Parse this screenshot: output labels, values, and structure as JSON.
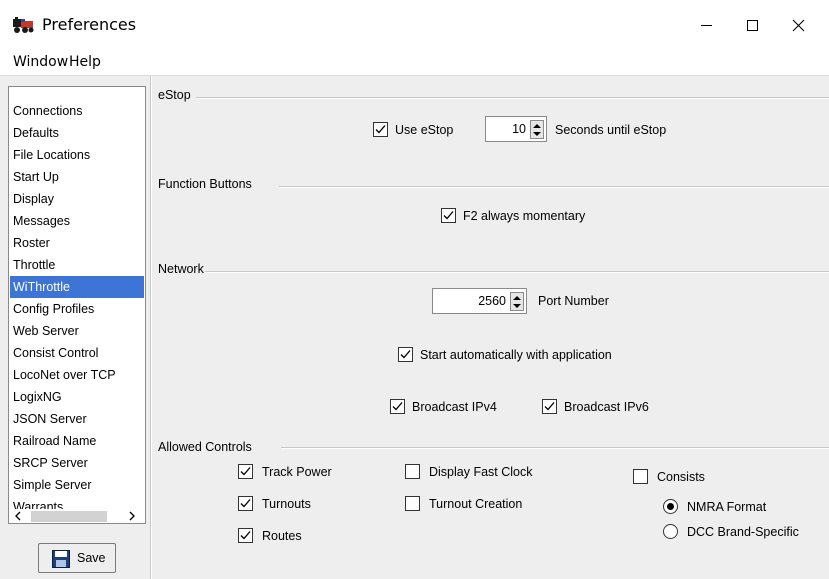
{
  "window": {
    "title": "Preferences",
    "icon": "locomotive-icon",
    "controls": [
      "minimize-icon",
      "maximize-icon",
      "close-icon"
    ]
  },
  "menu": {
    "window": "Window",
    "help": "Help"
  },
  "sidebar": {
    "items": [
      {
        "label": "Connections"
      },
      {
        "label": "Defaults"
      },
      {
        "label": "File Locations"
      },
      {
        "label": "Start Up"
      },
      {
        "label": "Display"
      },
      {
        "label": "Messages"
      },
      {
        "label": "Roster"
      },
      {
        "label": "Throttle"
      },
      {
        "label": "WiThrottle"
      },
      {
        "label": "Config Profiles"
      },
      {
        "label": "Web Server"
      },
      {
        "label": "Consist Control"
      },
      {
        "label": "LocoNet over TCP"
      },
      {
        "label": "LogixNG"
      },
      {
        "label": "JSON Server"
      },
      {
        "label": "Railroad Name"
      },
      {
        "label": "SRCP Server"
      },
      {
        "label": "Simple Server"
      },
      {
        "label": "Warrants"
      }
    ],
    "selected": "WiThrottle",
    "save_label": "Save",
    "selected_color": "#3d74d6"
  },
  "estop": {
    "title": "eStop",
    "use_label": "Use eStop",
    "use_checked": true,
    "seconds_value": "10",
    "seconds_label": "Seconds until eStop"
  },
  "function_buttons": {
    "title": "Function Buttons",
    "f2_label": "F2 always momentary",
    "f2_checked": true
  },
  "network": {
    "title": "Network",
    "port_value": "2560",
    "port_label": "Port Number",
    "auto_start_label": "Start automatically with application",
    "auto_start_checked": true,
    "ipv4_label": "Broadcast IPv4",
    "ipv4_checked": true,
    "ipv6_label": "Broadcast IPv6",
    "ipv6_checked": true
  },
  "allowed_controls": {
    "title": "Allowed Controls",
    "track_power": {
      "label": "Track Power",
      "checked": true
    },
    "turnouts": {
      "label": "Turnouts",
      "checked": true
    },
    "routes": {
      "label": "Routes",
      "checked": true
    },
    "fast_clock": {
      "label": "Display Fast Clock",
      "checked": false
    },
    "turnout_creation": {
      "label": "Turnout Creation",
      "checked": false
    },
    "consists": {
      "label": "Consists",
      "checked": false
    },
    "nmra_format": {
      "label": "NMRA Format",
      "selected": true
    },
    "dcc_brand": {
      "label": "DCC Brand-Specific",
      "selected": false
    }
  }
}
